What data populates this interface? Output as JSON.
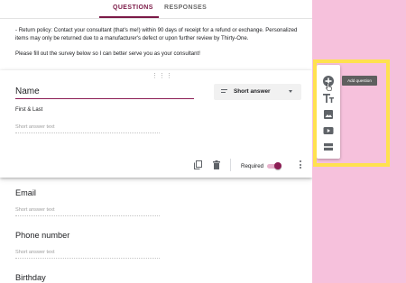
{
  "tabs": {
    "questions": "QUESTIONS",
    "responses": "RESPONSES"
  },
  "description": {
    "return_policy": "- Return policy: Contact your consultant (that's me!) within 90 days of receipt for a refund or exchange. Personalized items may only be returned due to a manufacturer's defect or upon further review by Thirty-One.",
    "instruction": "Please fill out the survey below so I can better serve you as your consultant!"
  },
  "active_question": {
    "drag_handle": "⋮⋮⋮",
    "title": "Name",
    "description": "First & Last",
    "answer_placeholder": "Short answer text",
    "type_label": "Short answer",
    "required_label": "Required",
    "required": true
  },
  "questions": [
    {
      "title": "Email",
      "answer_placeholder": "Short answer text"
    },
    {
      "title": "Phone number",
      "answer_placeholder": "Short answer text"
    },
    {
      "title": "Birthday"
    }
  ],
  "toolbar": {
    "items": [
      "add-question-icon",
      "add-title-icon",
      "add-image-icon",
      "add-video-icon",
      "add-section-icon"
    ],
    "tooltip": "Add question"
  },
  "colors": {
    "accent": "#7b1a47",
    "toggle_thumb": "#8c1d54",
    "background": "#f6c1dc",
    "highlight": "#ffe14f"
  }
}
